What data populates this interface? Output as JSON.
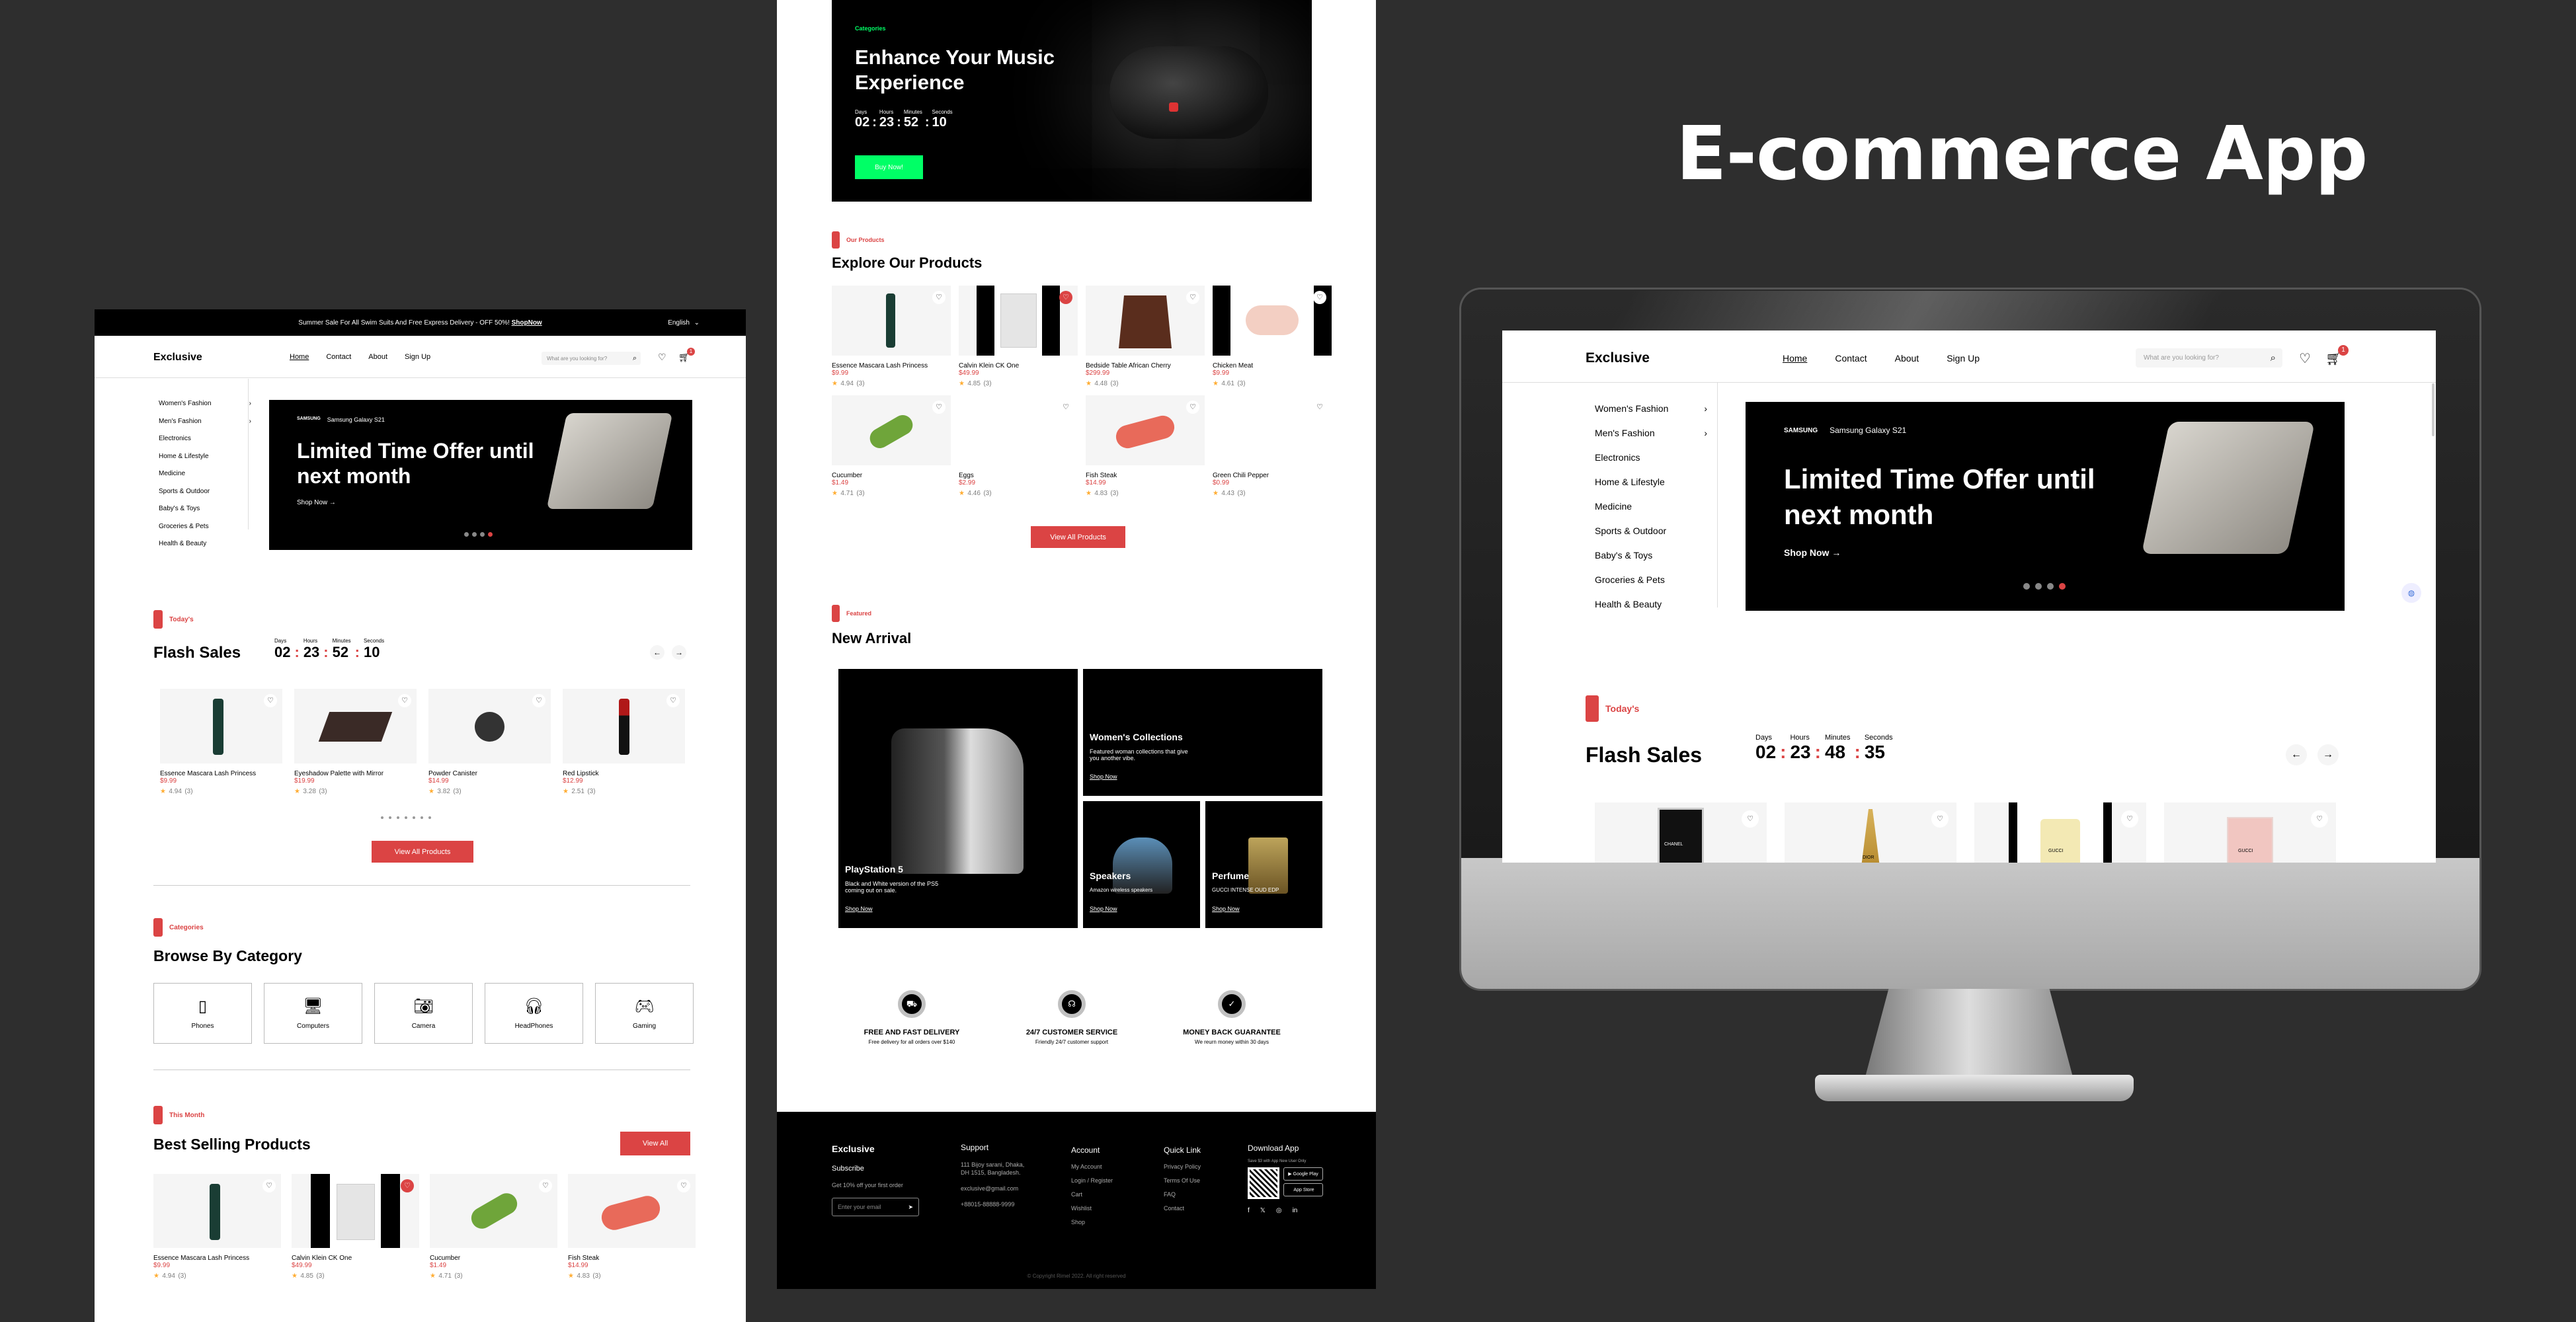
{
  "title": "E-commerce App",
  "brand": "Exclusive",
  "nav": [
    "Home",
    "Contact",
    "About",
    "Sign Up"
  ],
  "search_placeholder": "What are you looking for?",
  "cart_count": "1",
  "topbar": {
    "text": "Summer Sale For All Swim Suits And Free Express Delivery - OFF 50%!",
    "link": "ShopNow",
    "lang": "English"
  },
  "sidebar": [
    "Women's Fashion",
    "Men's Fashion",
    "Electronics",
    "Home & Lifestyle",
    "Medicine",
    "Sports & Outdoor",
    "Baby's & Toys",
    "Groceries & Pets",
    "Health & Beauty"
  ],
  "sidebar_desktop": [
    "Women's Fashion",
    "Men's Fashion",
    "Electronics",
    "Home & Lifestyle",
    "Medicine",
    "Sports & Outdoor",
    "Baby's & Toys",
    "Groceries & Pets",
    "Health & Beauty"
  ],
  "hero": {
    "brand": "SAMSUNG",
    "model": "Samsung Galaxy S21",
    "title": "Limited Time Offer until next month",
    "cta": "Shop Now"
  },
  "flash": {
    "tag": "Today's",
    "title": "Flash Sales",
    "labels": [
      "Days",
      "Hours",
      "Minutes",
      "Seconds"
    ],
    "timer": [
      "02",
      "23",
      "52",
      "10"
    ],
    "timer_desktop": [
      "02",
      "23",
      "48",
      "35"
    ],
    "products": [
      {
        "name": "Essence Mascara Lash Princess",
        "price": "$9.99",
        "rating": "4.94",
        "count": "(3)"
      },
      {
        "name": "Eyeshadow Palette with Mirror",
        "price": "$19.99",
        "rating": "3.28",
        "count": "(3)"
      },
      {
        "name": "Powder Canister",
        "price": "$14.99",
        "rating": "3.82",
        "count": "(3)"
      },
      {
        "name": "Red Lipstick",
        "price": "$12.99",
        "rating": "2.51",
        "count": "(3)"
      }
    ],
    "view_all": "View All Products"
  },
  "categories": {
    "tag": "Categories",
    "title": "Browse By Category",
    "items": [
      "Phones",
      "Computers",
      "Camera",
      "HeadPhones",
      "Gaming"
    ]
  },
  "best": {
    "tag": "This Month",
    "title": "Best Selling Products",
    "view_all": "View All",
    "products": [
      {
        "name": "Essence Mascara Lash Princess",
        "price": "$9.99",
        "rating": "4.94",
        "count": "(3)"
      },
      {
        "name": "Calvin Klein CK One",
        "price": "$49.99",
        "rating": "4.85",
        "count": "(3)"
      },
      {
        "name": "Cucumber",
        "price": "$1.49",
        "rating": "4.71",
        "count": "(3)"
      },
      {
        "name": "Fish Steak",
        "price": "$14.99",
        "rating": "4.83",
        "count": "(3)"
      }
    ]
  },
  "music": {
    "tag": "Categories",
    "title": "Enhance Your Music Experience",
    "labels": [
      "Days",
      "Hours",
      "Minutes",
      "Seconds"
    ],
    "timer": [
      "02",
      "23",
      "52",
      "10"
    ],
    "cta": "Buy Now!"
  },
  "explore": {
    "tag": "Our Products",
    "title": "Explore Our Products",
    "view_all": "View All Products",
    "products": [
      {
        "name": "Essence Mascara Lash Princess",
        "price": "$9.99",
        "rating": "4.94",
        "count": "(3)"
      },
      {
        "name": "Calvin Klein CK One",
        "price": "$49.99",
        "rating": "4.85",
        "count": "(3)"
      },
      {
        "name": "Bedside Table African Cherry",
        "price": "$299.99",
        "rating": "4.48",
        "count": "(3)"
      },
      {
        "name": "Chicken Meat",
        "price": "$9.99",
        "rating": "4.61",
        "count": "(3)"
      },
      {
        "name": "Cucumber",
        "price": "$1.49",
        "rating": "4.71",
        "count": "(3)"
      },
      {
        "name": "Eggs",
        "price": "$2.99",
        "rating": "4.46",
        "count": "(3)"
      },
      {
        "name": "Fish Steak",
        "price": "$14.99",
        "rating": "4.83",
        "count": "(3)"
      },
      {
        "name": "Green Chili Pepper",
        "price": "$0.99",
        "rating": "4.43",
        "count": "(3)"
      }
    ]
  },
  "arrival": {
    "tag": "Featured",
    "title": "New Arrival",
    "ps5": {
      "title": "PlayStation 5",
      "desc": "Black and White version of the PS5 coming out on sale.",
      "cta": "Shop Now"
    },
    "women": {
      "title": "Women's Collections",
      "desc": "Featured woman collections that give you another vibe.",
      "cta": "Shop Now"
    },
    "speakers": {
      "title": "Speakers",
      "desc": "Amazon wireless speakers",
      "cta": "Shop Now"
    },
    "perfume": {
      "title": "Perfume",
      "desc": "GUCCI INTENSE OUD EDP",
      "cta": "Shop Now"
    }
  },
  "services": [
    {
      "title": "FREE AND FAST DELIVERY",
      "desc": "Free delivery for all orders over $140"
    },
    {
      "title": "24/7 CUSTOMER SERVICE",
      "desc": "Friendly 24/7 customer support"
    },
    {
      "title": "MONEY BACK GUARANTEE",
      "desc": "We reurn money within 30 days"
    }
  ],
  "footer": {
    "brand": "Exclusive",
    "subscribe": "Subscribe",
    "offer": "Get 10% off your first order",
    "email_placeholder": "Enter your email",
    "support_title": "Support",
    "support": [
      "111 Bijoy sarani, Dhaka, DH 1515, Bangladesh.",
      "exclusive@gmail.com",
      "+88015-88888-9999"
    ],
    "account_title": "Account",
    "account": [
      "My Account",
      "Login / Register",
      "Cart",
      "Wishlist",
      "Shop"
    ],
    "quick_title": "Quick Link",
    "quick": [
      "Privacy Policy",
      "Terms Of Use",
      "FAQ",
      "Contact"
    ],
    "download_title": "Download App",
    "download_note": "Save $3 with App New User Only",
    "google": "Google Play",
    "apple": "App Store",
    "copyright": "© Copyright Rimel 2022. All right reserved"
  },
  "desktop_flash_products": [
    "CHANEL",
    "DIOR",
    "GUCCI",
    "GUCCI"
  ],
  "colors": {
    "accent": "#DB4444",
    "green": "#00FF66",
    "bg": "#2e2e2e"
  }
}
